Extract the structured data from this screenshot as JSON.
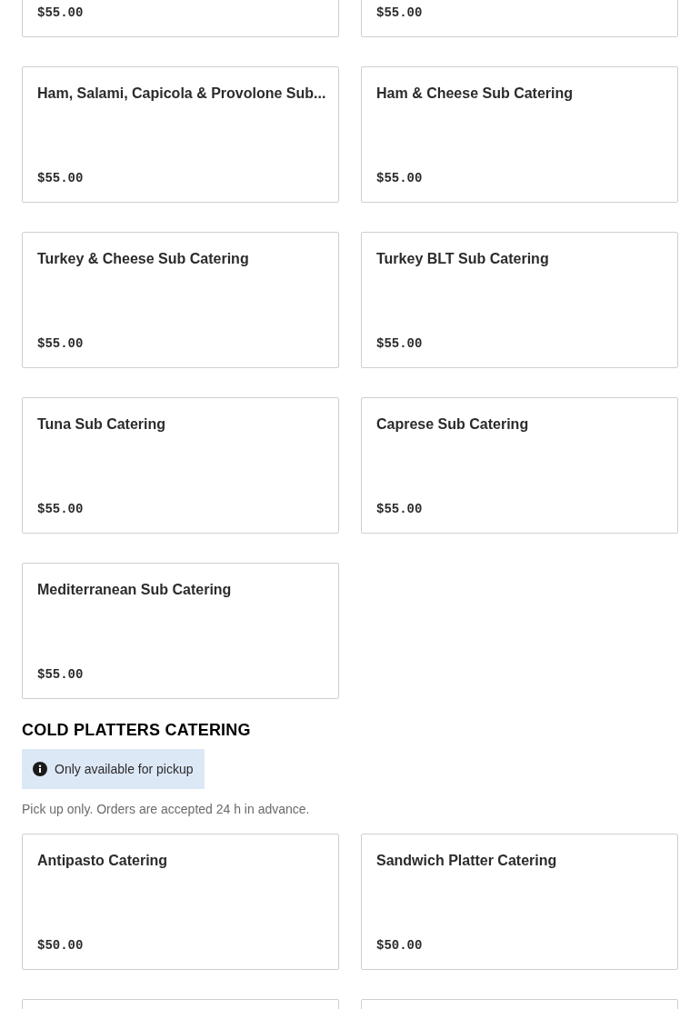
{
  "sections": [
    {
      "items": [
        {
          "price": "$55.00"
        },
        {
          "price": "$55.00"
        },
        {
          "name": "Ham, Salami, Capicola & Provolone Sub...",
          "price": "$55.00"
        },
        {
          "name": "Ham & Cheese Sub Catering",
          "price": "$55.00"
        },
        {
          "name": "Turkey & Cheese Sub Catering",
          "price": "$55.00"
        },
        {
          "name": "Turkey BLT Sub Catering",
          "price": "$55.00"
        },
        {
          "name": "Tuna Sub Catering",
          "price": "$55.00"
        },
        {
          "name": "Caprese Sub Catering",
          "price": "$55.00"
        },
        {
          "name": "Mediterranean Sub Catering",
          "price": "$55.00"
        }
      ]
    },
    {
      "title": "COLD PLATTERS CATERING",
      "notice": "Only available for pickup",
      "description": "Pick up only. Orders are accepted 24 h in advance.",
      "items": [
        {
          "name": "Antipasto Catering",
          "price": "$50.00"
        },
        {
          "name": "Sandwich Platter Catering",
          "price": "$50.00"
        }
      ]
    }
  ]
}
